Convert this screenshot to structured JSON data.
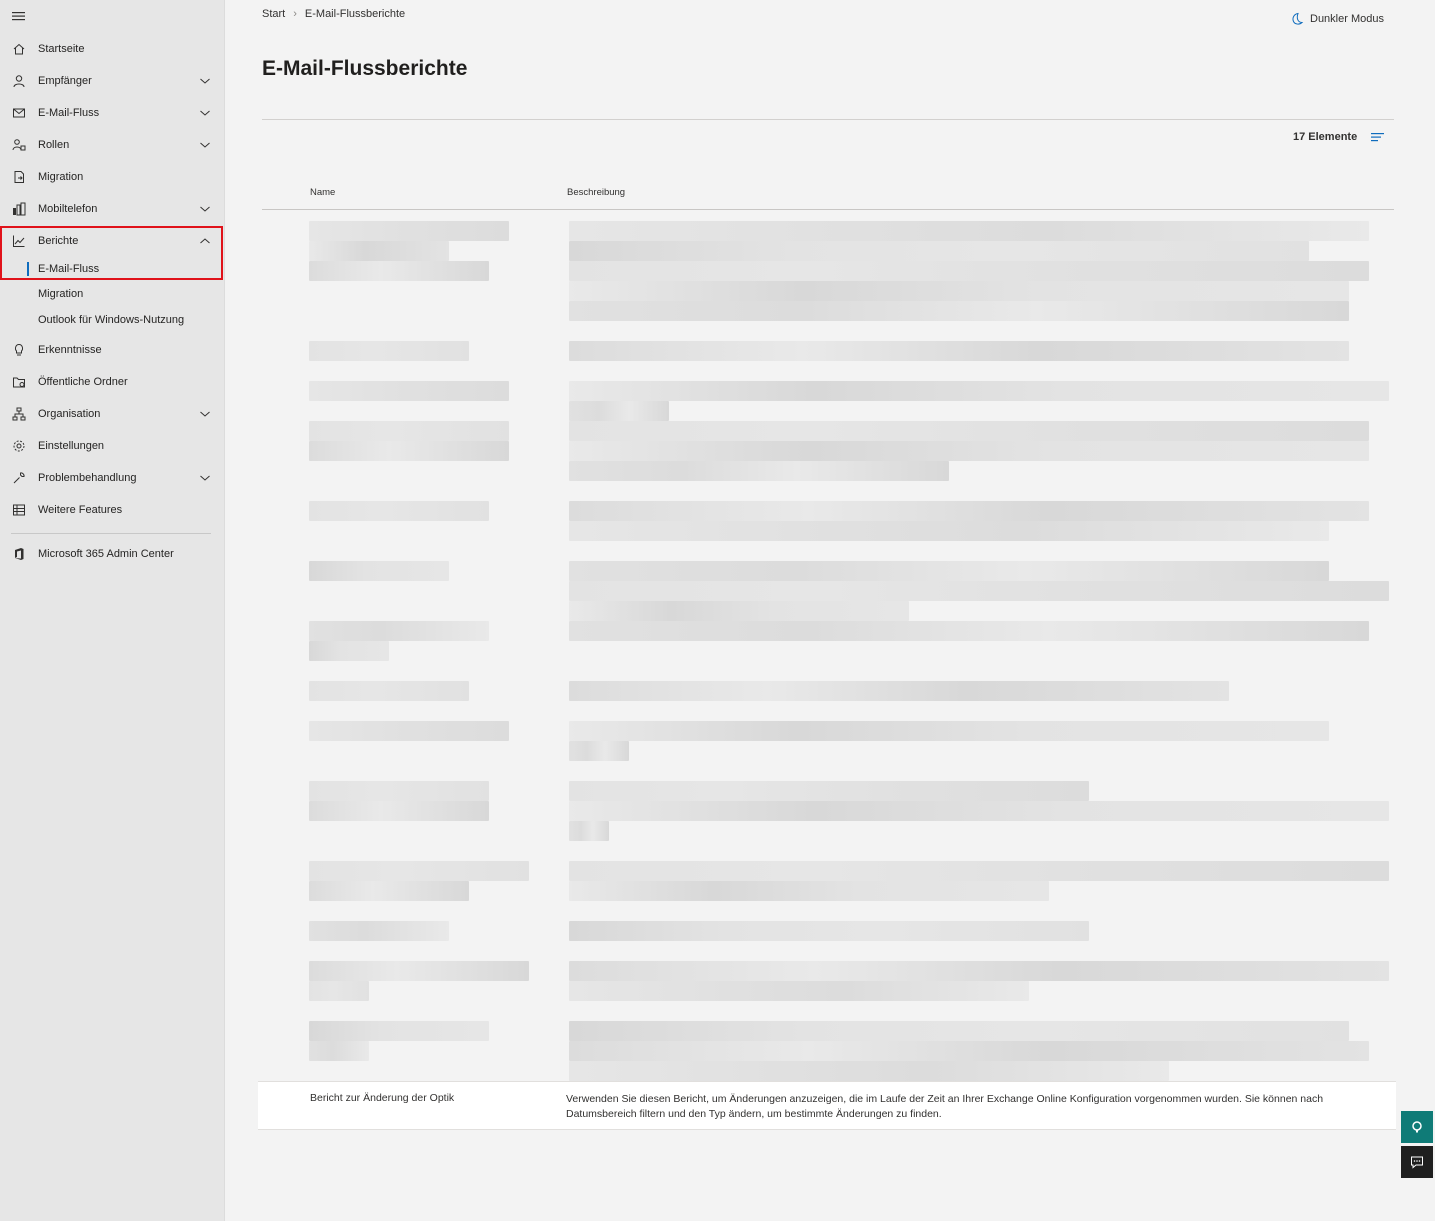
{
  "breadcrumb": {
    "start": "Start",
    "current": "E-Mail-Flussberichte"
  },
  "header": {
    "dark_mode_label": "Dunkler Modus"
  },
  "page": {
    "title": "E-Mail-Flussberichte",
    "item_count": "17 Elemente"
  },
  "table": {
    "columns": [
      "Name",
      "Beschreibung"
    ],
    "visible_row": {
      "name": "Bericht zur Änderung der Optik",
      "description": "Verwenden Sie diesen Bericht, um Änderungen anzuzeigen, die im Laufe der Zeit an Ihrer Exchange Online Konfiguration vorgenommen wurden. Sie können nach Datumsbereich filtern und den Typ ändern, um bestimmte Änderungen zu finden."
    }
  },
  "sidebar": {
    "items": [
      {
        "label": "Startseite",
        "icon": "home-icon"
      },
      {
        "label": "Empfänger",
        "icon": "person-icon"
      },
      {
        "label": "E-Mail-Fluss",
        "icon": "mail-icon"
      },
      {
        "label": "Rollen",
        "icon": "roles-icon"
      },
      {
        "label": "Migration",
        "icon": "migration-icon"
      },
      {
        "label": "Mobiltelefon",
        "icon": "mobile-icon"
      },
      {
        "label": "Berichte",
        "icon": "chart-icon"
      },
      {
        "label": "Erkenntnisse",
        "icon": "lightbulb-icon"
      },
      {
        "label": "Öffentliche Ordner",
        "icon": "folder-icon"
      },
      {
        "label": "Organisation",
        "icon": "org-icon"
      },
      {
        "label": "Einstellungen",
        "icon": "gear-icon"
      },
      {
        "label": "Problembehandlung",
        "icon": "wrench-icon"
      },
      {
        "label": "Weitere Features",
        "icon": "table-icon"
      }
    ],
    "reports_sub": [
      {
        "label": "E-Mail-Fluss"
      },
      {
        "label": "Migration"
      },
      {
        "label": "Outlook für Windows-Nutzung"
      }
    ],
    "admin_center": "Microsoft 365 Admin Center"
  }
}
